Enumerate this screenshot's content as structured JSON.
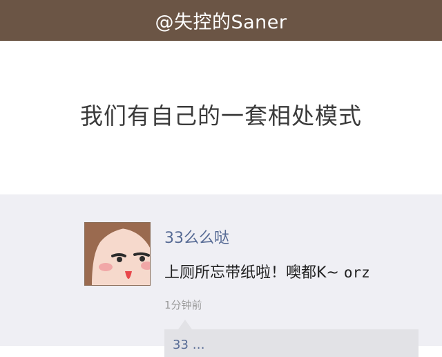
{
  "header": {
    "handle": "@失控的Saner"
  },
  "headline": {
    "text": "我们有自己的一套相处模式"
  },
  "post": {
    "author": "33么么哒",
    "content_cn": "上厕所忘带纸啦！噢都K~ ",
    "content_latin": "orz",
    "time": "1分钟前"
  },
  "comments": [
    {
      "text": "33 …"
    }
  ],
  "colors": {
    "topbar": "#6b5545",
    "feed_bg": "#efeff4",
    "name_link": "#576b95"
  }
}
